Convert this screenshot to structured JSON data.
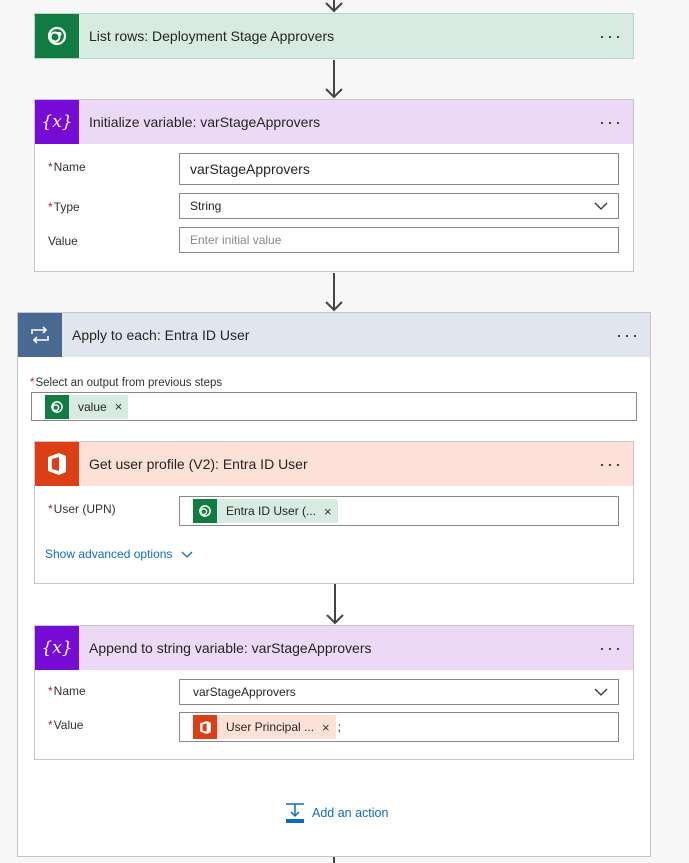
{
  "colors": {
    "dataverse_header": "#d8ebe3",
    "dataverse_icon": "#107c41",
    "variable_header": "#ecd9f5",
    "variable_icon": "#770bd6",
    "loop_header": "#e1e6ee",
    "loop_icon": "#486991",
    "office_header": "#fde0d8",
    "office_icon": "#dc3e15",
    "required": "#a4262c",
    "link": "#0f6cbd"
  },
  "list_rows": {
    "title": "List rows: Deployment Stage Approvers",
    "icon": "dataverse-icon",
    "more": "···"
  },
  "init_variable": {
    "title": "Initialize variable: varStageApprovers",
    "icon": "variable-icon",
    "more": "···",
    "name_label": "Name",
    "name_value": "varStageApprovers",
    "type_label": "Type",
    "type_value": "String",
    "value_label": "Value",
    "value_placeholder": "Enter initial value"
  },
  "apply_to_each": {
    "title": "Apply to each: Entra ID User",
    "icon": "loop-icon",
    "more": "···",
    "select_label": "Select an output from previous steps",
    "token_label": "value",
    "token_remove": "×"
  },
  "get_user_profile": {
    "title": "Get user profile (V2): Entra ID User",
    "icon": "office-icon",
    "more": "···",
    "user_label": "User (UPN)",
    "token_label": "Entra ID User (...",
    "token_remove": "×",
    "advanced_link": "Show advanced options"
  },
  "append_variable": {
    "title": "Append to string variable: varStageApprovers",
    "icon": "variable-icon",
    "more": "···",
    "name_label": "Name",
    "name_value": "varStageApprovers",
    "value_label": "Value",
    "token_label": "User Principal ...",
    "token_remove": "×",
    "suffix": ";"
  },
  "add_action": {
    "label": "Add an action",
    "icon": "add-action-icon"
  }
}
